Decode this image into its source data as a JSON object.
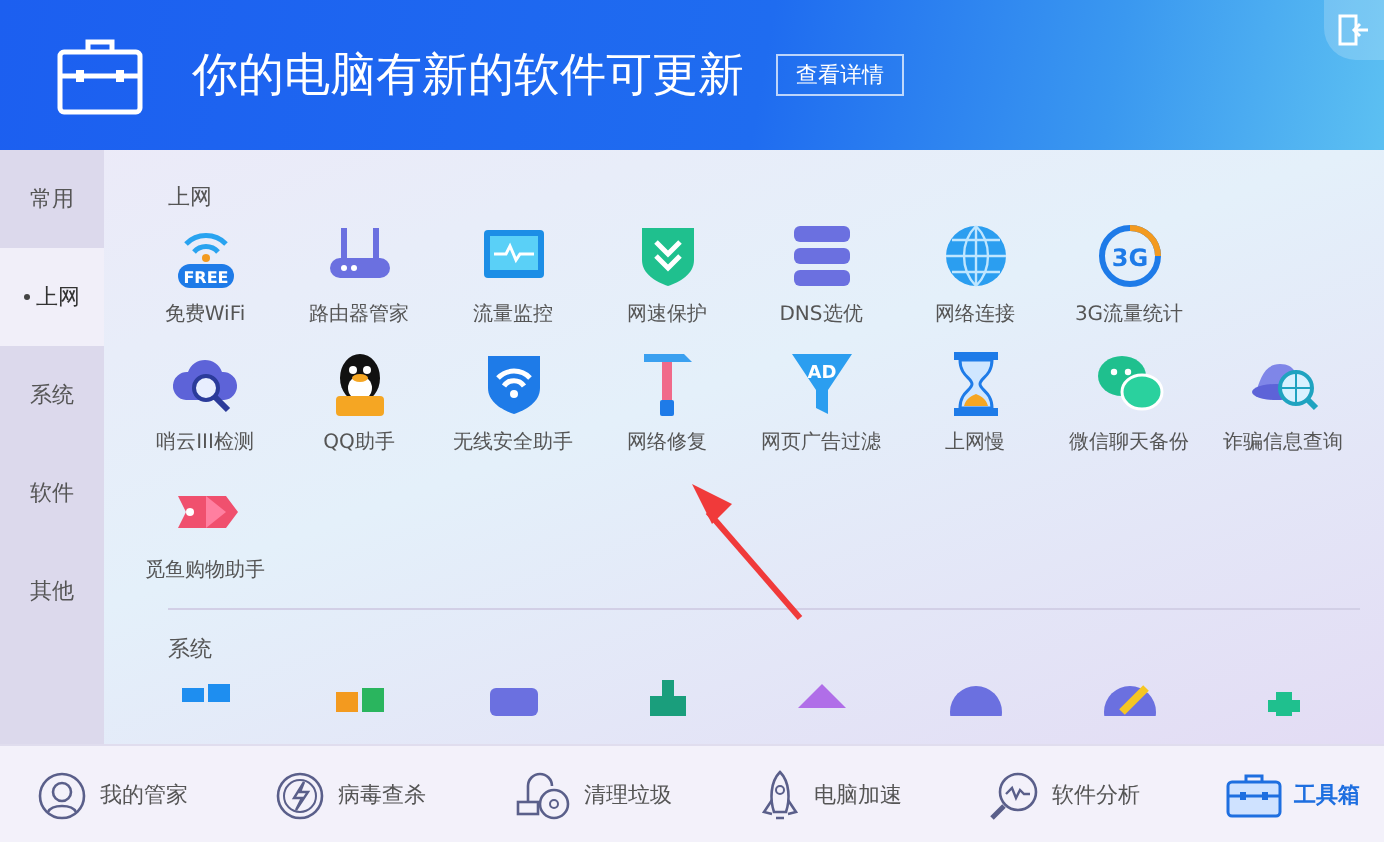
{
  "header": {
    "title": "你的电脑有新的软件可更新",
    "details_button": "查看详情"
  },
  "sidebar": {
    "items": [
      {
        "label": "常用",
        "selected": false
      },
      {
        "label": "上网",
        "selected": true
      },
      {
        "label": "系统",
        "selected": false
      },
      {
        "label": "软件",
        "selected": false
      },
      {
        "label": "其他",
        "selected": false
      }
    ]
  },
  "sections": [
    {
      "title": "上网",
      "rows": [
        [
          {
            "label": "免费WiFi",
            "kind": "wifi",
            "badge": "FREE"
          },
          {
            "label": "路由器管家",
            "kind": "router"
          },
          {
            "label": "流量监控",
            "kind": "monitor"
          },
          {
            "label": "网速保护",
            "kind": "shield"
          },
          {
            "label": "DNS选优",
            "kind": "server"
          },
          {
            "label": "网络连接",
            "kind": "globe"
          },
          {
            "label": "3G流量统计",
            "kind": "ring",
            "badge": "3G"
          }
        ],
        [
          {
            "label": "哨云III检测",
            "kind": "cloud"
          },
          {
            "label": "QQ助手",
            "kind": "penguin"
          },
          {
            "label": "无线安全助手",
            "kind": "wifishield"
          },
          {
            "label": "网络修复",
            "kind": "hammer"
          },
          {
            "label": "网页广告过滤",
            "kind": "funnel",
            "badge": "AD"
          },
          {
            "label": "上网慢",
            "kind": "hourglass"
          },
          {
            "label": "微信聊天备份",
            "kind": "chat"
          },
          {
            "label": "诈骗信息查询",
            "kind": "spy"
          }
        ],
        [
          {
            "label": "觅鱼购物助手",
            "kind": "tag"
          }
        ]
      ]
    },
    {
      "title": "系统"
    }
  ],
  "bottom_nav": [
    {
      "label": "我的管家",
      "kind": "person",
      "selected": false
    },
    {
      "label": "病毒查杀",
      "kind": "bolt",
      "selected": false
    },
    {
      "label": "清理垃圾",
      "kind": "vacuum",
      "selected": false
    },
    {
      "label": "电脑加速",
      "kind": "rocket",
      "selected": false
    },
    {
      "label": "软件分析",
      "kind": "magnifier",
      "selected": false
    },
    {
      "label": "工具箱",
      "kind": "toolbox",
      "selected": true
    }
  ]
}
